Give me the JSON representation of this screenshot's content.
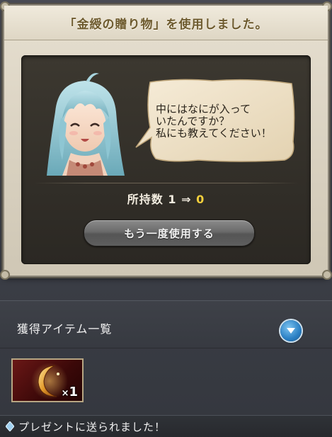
{
  "dialog": {
    "title": "「金綬の贈り物」を使用しました。",
    "speech": "中にはなにが入って\nいたんですか？\n私にも教えてください！",
    "count_label": "所持数",
    "count_before": "1",
    "count_arrow": "⇒",
    "count_after": "0",
    "reuse_label": "もう一度使用する"
  },
  "acquired": {
    "title": "獲得アイテム一覧",
    "toggle_icon": "chevron-down-icon",
    "items": [
      {
        "icon": "crescent-moon-icon",
        "qty_prefix": "×",
        "qty": "1"
      }
    ]
  },
  "notice": {
    "icon": "diamond-icon",
    "text": "プレゼントに送られました！"
  },
  "colors": {
    "highlight": "#f3cf3c",
    "toggle_blue": "#2a7fc3",
    "title_text": "#6d5a2e"
  }
}
